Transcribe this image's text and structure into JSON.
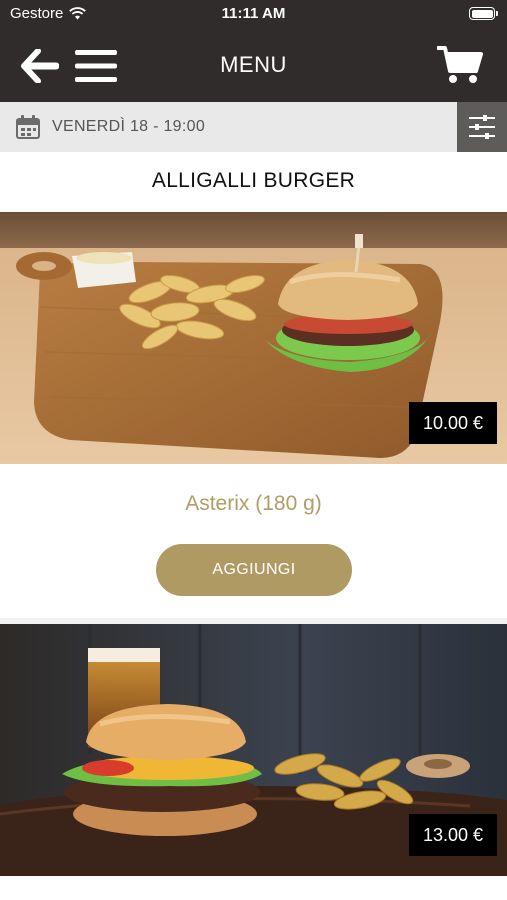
{
  "status_bar": {
    "carrier": "Gestore",
    "time": "11:11 AM"
  },
  "header": {
    "title": "MENU"
  },
  "date_bar": {
    "date": "VENERDÌ 18 - 19:00"
  },
  "category": {
    "title": "ALLIGALLI BURGER"
  },
  "products": [
    {
      "name": "Asterix (180 g)",
      "price": "10.00 €",
      "add_label": "AGGIUNGI"
    },
    {
      "price": "13.00 €"
    }
  ],
  "colors": {
    "header_bg": "#2f2c2b",
    "accent_gold": "#b09a64",
    "date_bar_bg": "#e9e9e9",
    "filter_bg": "#5e5c5b"
  }
}
